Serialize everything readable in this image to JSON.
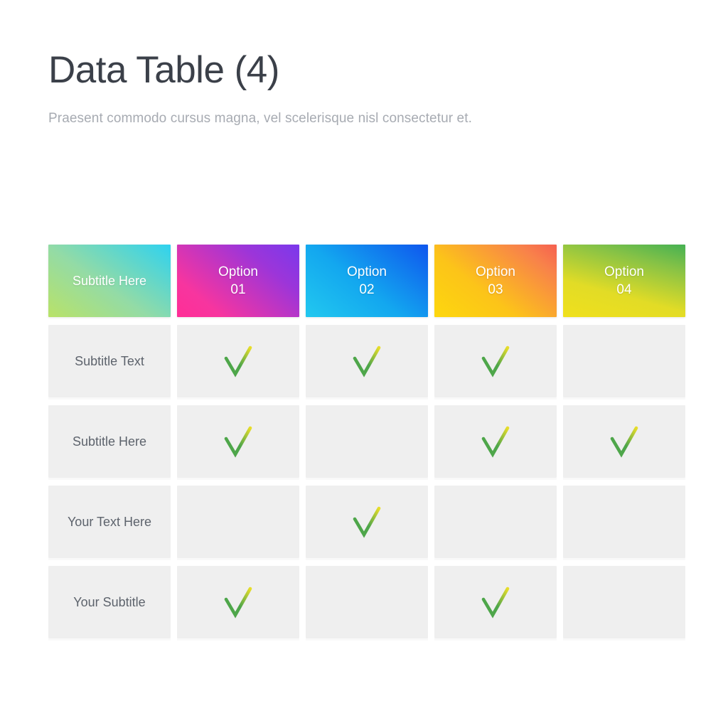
{
  "header": {
    "title": "Data Table (4)",
    "subtitle": "Praesent commodo cursus magna, vel scelerisque nisl consectetur et."
  },
  "table": {
    "columns": [
      {
        "label": "Subtitle Here",
        "gradient_from": "#b9e268",
        "gradient_to": "#2ed2f0"
      },
      {
        "label": "Option\n01",
        "gradient_from": "#ff2e96",
        "gradient_to": "#7a39ec"
      },
      {
        "label": "Option\n02",
        "gradient_from": "#22c8ef",
        "gradient_to": "#0f56ee"
      },
      {
        "label": "Option\n03",
        "gradient_from": "#fdd70e",
        "gradient_to": "#f66050"
      },
      {
        "label": "Option\n04",
        "gradient_from": "#f0e01c",
        "gradient_to": "#45b153"
      }
    ],
    "check_icon_name": "check-mark-icon",
    "check_color_start": "#4ea64a",
    "check_color_end": "#e8dd2a",
    "cell_background": "#efefef",
    "rows": [
      {
        "label": "Subtitle Text",
        "checks": [
          true,
          true,
          true,
          false
        ]
      },
      {
        "label": "Subtitle Here",
        "checks": [
          true,
          false,
          true,
          true
        ]
      },
      {
        "label": "Your Text Here",
        "checks": [
          false,
          true,
          false,
          false
        ]
      },
      {
        "label": "Your Subtitle",
        "checks": [
          true,
          false,
          true,
          false
        ]
      }
    ]
  }
}
